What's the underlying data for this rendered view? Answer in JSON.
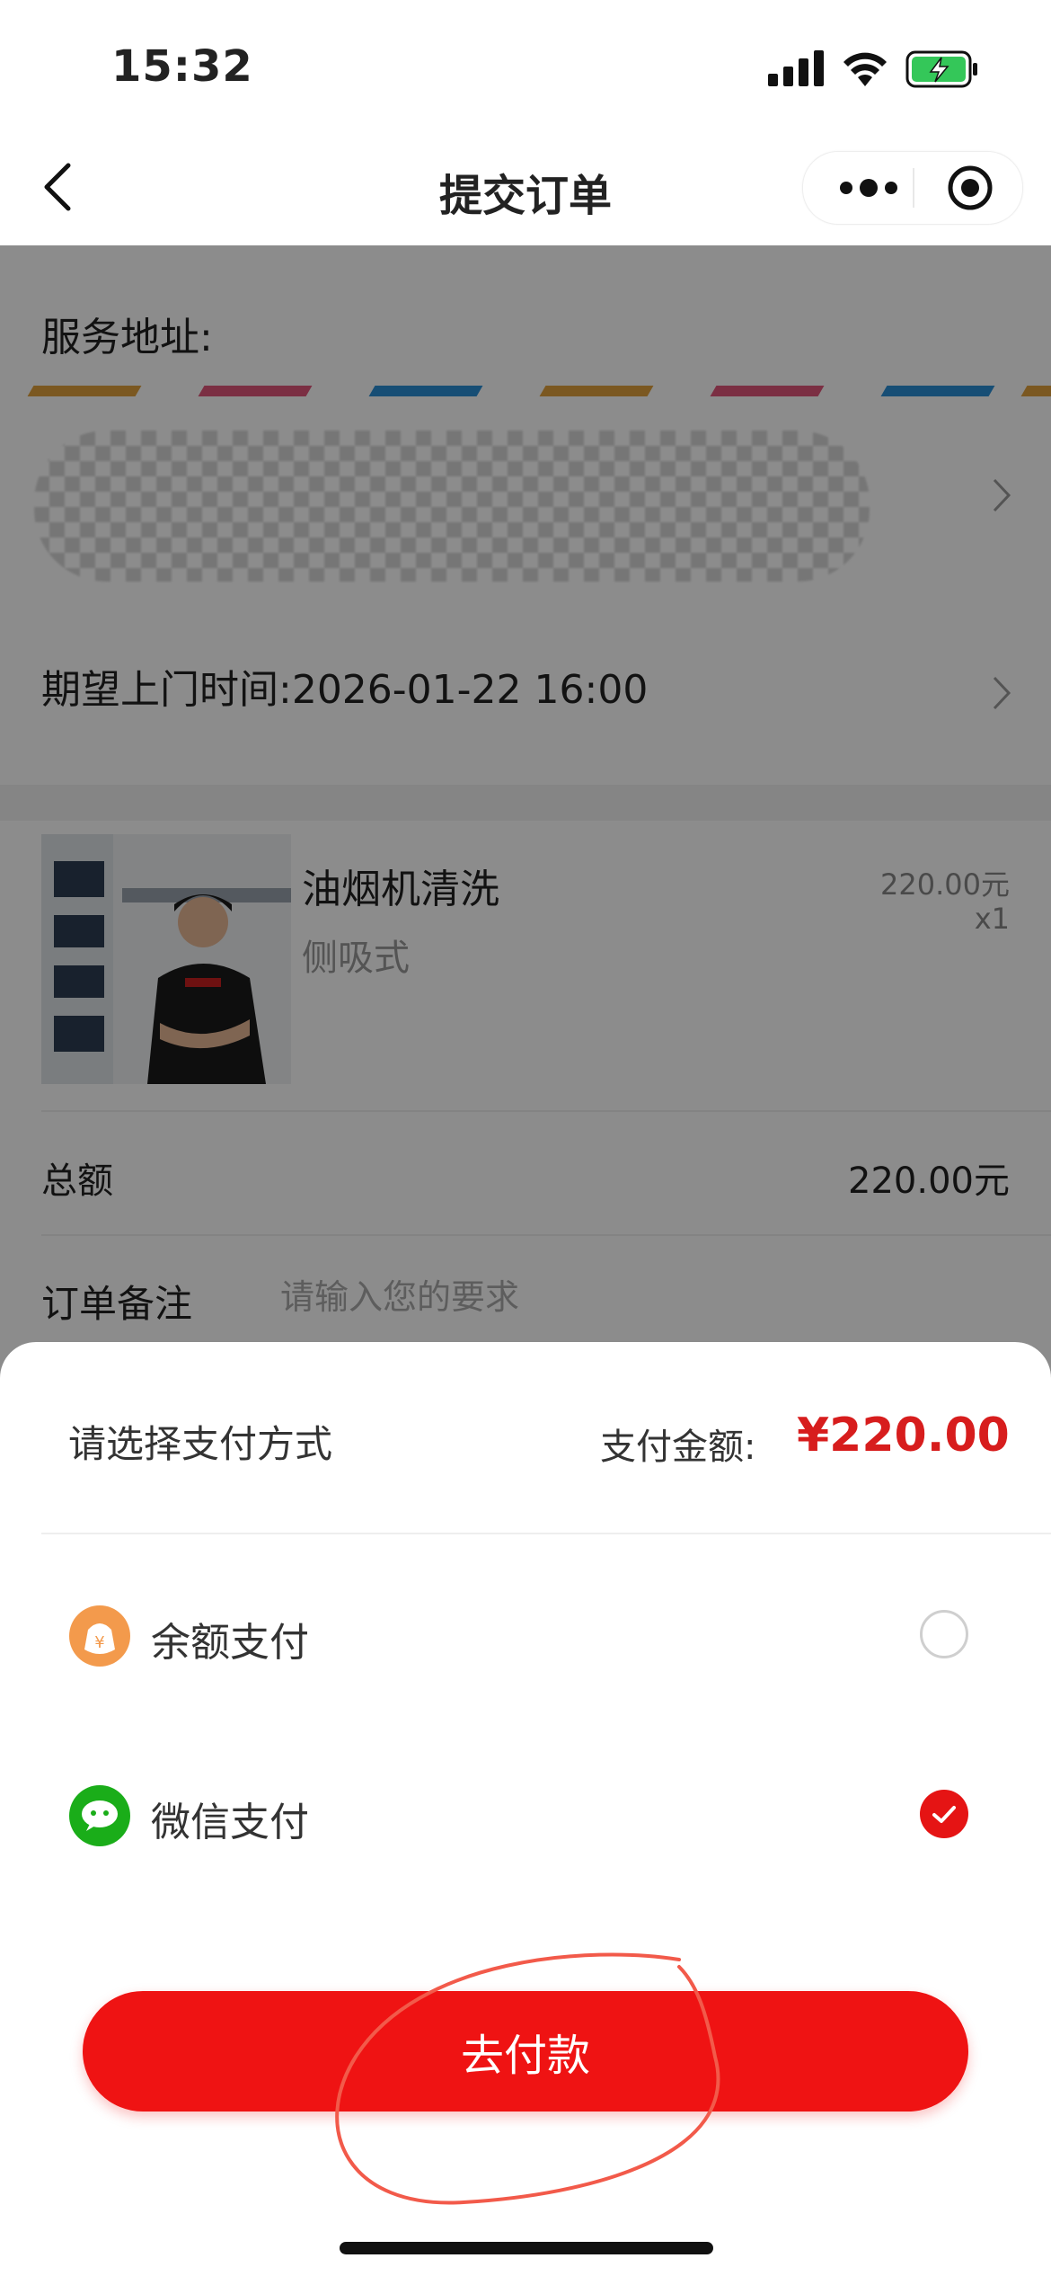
{
  "status_bar": {
    "time": "15:32"
  },
  "nav": {
    "title": "提交订单"
  },
  "address": {
    "label": "服务地址:"
  },
  "visit_time": {
    "text": "期望上门时间:2026-01-22 16:00"
  },
  "product": {
    "name": "油烟机清洗",
    "spec": "侧吸式",
    "price": "220.00元",
    "qty": "x1"
  },
  "total": {
    "label": "总额",
    "value": "220.00元"
  },
  "note": {
    "label": "订单备注",
    "placeholder": "请输入您的要求"
  },
  "payment_sheet": {
    "title": "请选择支付方式",
    "amount_label": "支付金额:",
    "amount": "¥220.00",
    "options": [
      {
        "label": "余额支付",
        "selected": false,
        "icon": "wallet-icon"
      },
      {
        "label": "微信支付",
        "selected": true,
        "icon": "wechat-icon"
      }
    ],
    "pay_button": "去付款"
  },
  "colors": {
    "accent": "#ef1313",
    "price_red": "#d71d1d",
    "wechat_green": "#1aad19",
    "wallet_orange": "#f39a4c"
  }
}
